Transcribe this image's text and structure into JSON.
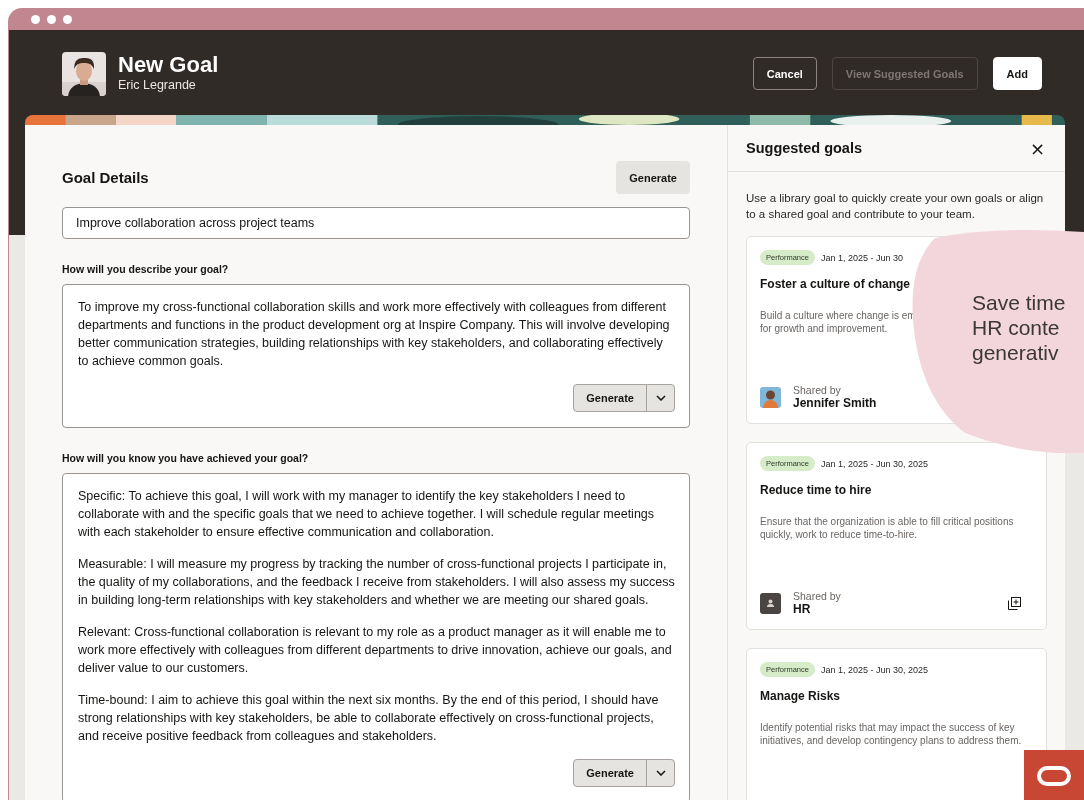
{
  "header": {
    "title": "New Goal",
    "subtitle": "Eric Legrande",
    "buttons": [
      {
        "label": "Cancel",
        "kind": "outline",
        "disabled": false
      },
      {
        "label": "View Suggested Goals",
        "kind": "outline",
        "disabled": true
      },
      {
        "label": "Add",
        "kind": "solid",
        "disabled": false
      }
    ]
  },
  "goal_details": {
    "heading": "Goal Details",
    "generate_button": "Generate",
    "goal_name": "Improve collaboration across project teams",
    "sections": [
      {
        "label": "How will you describe your goal?",
        "paragraphs": [
          "To improve my cross-functional collaboration skills and work more effectively with colleagues from different departments and functions in the product development org at Inspire Company. This will involve developing better communication strategies, building relationships with key stakeholders, and collaborating effectively to achieve common goals."
        ],
        "generate_button": "Generate"
      },
      {
        "label": "How will you know you have achieved your goal?",
        "paragraphs": [
          "Specific: To achieve this goal, I will work with my manager to identify the key stakeholders I need to collaborate with and the specific goals that we need to achieve together. I will schedule regular meetings with each stakeholder to ensure effective communication and collaboration.",
          "Measurable: I will measure my progress by tracking the number of cross-functional projects I participate in, the quality of my collaborations, and the feedback I receive from stakeholders. I will also assess my success in building long-term relationships with key stakeholders and whether we are meeting our shared goals.",
          "Relevant: Cross-functional collaboration is relevant to my role as a product manager as it will enable me to work more effectively with colleagues from different departments to drive innovation, achieve our goals, and deliver value to our customers.",
          "Time-bound: I aim to achieve this goal within the next six months. By the end of this period, I should have strong relationships with key stakeholders, be able to collaborate effectively on cross-functional projects, and receive positive feedback from colleagues and stakeholders."
        ],
        "generate_button": "Generate"
      }
    ]
  },
  "suggested_goals": {
    "title": "Suggested goals",
    "close": "×",
    "intro": "Use a library goal to quickly create your own goals or align to a shared goal and contribute to your team.",
    "cards": [
      {
        "tag": "Performance",
        "dates": "Jan 1, 2025 - Jun 30",
        "title": "Foster a culture of change",
        "description": "Build a culture where change is em\nfor growth and improvement.",
        "shared_label": "Shared by",
        "sharer": {
          "name": "Jennifer Smith",
          "kind": "person"
        }
      },
      {
        "tag": "Performance",
        "dates": "Jan 1, 2025 - Jun 30, 2025",
        "title": "Reduce time to hire",
        "description": "Ensure that the organization is able to fill critical positions quickly, work to reduce time-to-hire.",
        "shared_label": "Shared by",
        "sharer": {
          "name": "HR",
          "kind": "team"
        },
        "copy_button": true
      },
      {
        "tag": "Performance",
        "dates": "Jan 1, 2025 - Jun 30, 2025",
        "title": "Manage Risks",
        "description": "Identify potential risks that may impact the success of key initiatives, and develop contingency plans to address them."
      }
    ]
  },
  "overlay_text": "Save time\nHR conte\ngenerativ"
}
